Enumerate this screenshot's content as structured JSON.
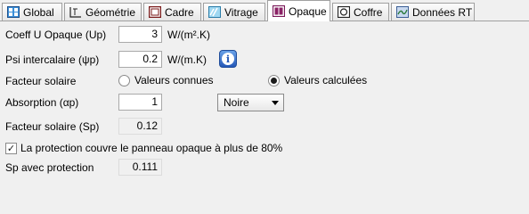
{
  "tabs": [
    {
      "label": "Global",
      "icon": "global-icon"
    },
    {
      "label": "Géométrie",
      "icon": "geometry-icon"
    },
    {
      "label": "Cadre",
      "icon": "frame-icon"
    },
    {
      "label": "Vitrage",
      "icon": "glazing-icon"
    },
    {
      "label": "Opaque",
      "icon": "opaque-icon",
      "active": true
    },
    {
      "label": "Coffre",
      "icon": "box-icon"
    },
    {
      "label": "Données RT",
      "icon": "rt-data-icon"
    }
  ],
  "form": {
    "coeff_u": {
      "label": "Coeff U Opaque (Up)",
      "value": "3",
      "unit": "W/(m².K)"
    },
    "psi": {
      "label": "Psi intercalaire (ψp)",
      "value": "0.2",
      "unit": "W/(m.K)"
    },
    "facteur_solaire": {
      "label": "Facteur solaire",
      "option_known": "Valeurs connues",
      "option_calc": "Valeurs calculées",
      "selected": "Valeurs calculées"
    },
    "absorption": {
      "label": "Absorption (αp)",
      "value": "1",
      "color_selected": "Noire"
    },
    "facteur_sp": {
      "label": "Facteur solaire (Sp)",
      "value": "0.12"
    },
    "protection": {
      "label": "La protection couvre le panneau opaque à plus de 80%",
      "checked": true
    },
    "sp_protection": {
      "label": "Sp avec protection",
      "value": "0.111"
    }
  },
  "colors": {
    "info_button": "#2458b8"
  }
}
